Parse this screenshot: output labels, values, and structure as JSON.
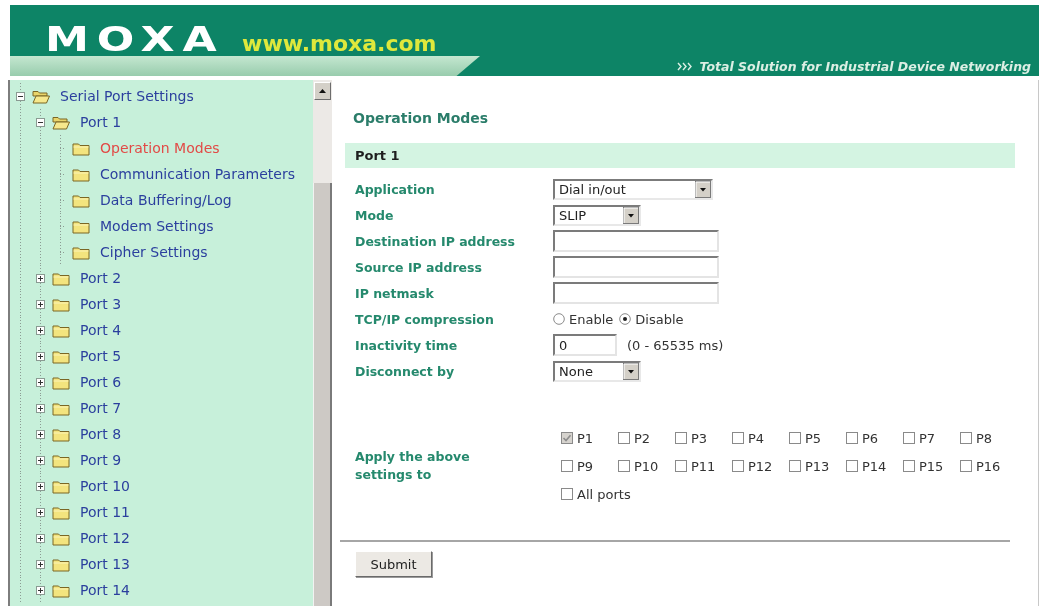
{
  "header": {
    "logo": "MOXA",
    "website": "www.moxa.com",
    "tagline": "Total Solution for Industrial Device Networking"
  },
  "sidebar": {
    "tree": [
      {
        "label": "Serial Port Settings",
        "expanded": true,
        "selected": false,
        "children": [
          {
            "label": "Port 1",
            "expanded": true,
            "selected": false,
            "children": [
              {
                "label": "Operation Modes",
                "selected": true
              },
              {
                "label": "Communication Parameters",
                "selected": false
              },
              {
                "label": "Data Buffering/Log",
                "selected": false
              },
              {
                "label": "Modem Settings",
                "selected": false
              },
              {
                "label": "Cipher Settings",
                "selected": false
              }
            ]
          },
          {
            "label": "Port 2",
            "expanded": false,
            "selected": false
          },
          {
            "label": "Port 3",
            "expanded": false,
            "selected": false
          },
          {
            "label": "Port 4",
            "expanded": false,
            "selected": false
          },
          {
            "label": "Port 5",
            "expanded": false,
            "selected": false
          },
          {
            "label": "Port 6",
            "expanded": false,
            "selected": false
          },
          {
            "label": "Port 7",
            "expanded": false,
            "selected": false
          },
          {
            "label": "Port 8",
            "expanded": false,
            "selected": false
          },
          {
            "label": "Port 9",
            "expanded": false,
            "selected": false
          },
          {
            "label": "Port 10",
            "expanded": false,
            "selected": false
          },
          {
            "label": "Port 11",
            "expanded": false,
            "selected": false
          },
          {
            "label": "Port 12",
            "expanded": false,
            "selected": false
          },
          {
            "label": "Port 13",
            "expanded": false,
            "selected": false
          },
          {
            "label": "Port 14",
            "expanded": false,
            "selected": false
          }
        ]
      }
    ]
  },
  "content": {
    "title": "Operation Modes",
    "section": "Port 1",
    "fields": [
      {
        "kind": "select",
        "label": "Application",
        "value": "Dial in/out"
      },
      {
        "kind": "select",
        "label": "Mode",
        "value": "SLIP"
      },
      {
        "kind": "text",
        "label": "Destination IP address"
      },
      {
        "kind": "text",
        "label": "Source IP address"
      },
      {
        "kind": "text",
        "label": "IP netmask"
      },
      {
        "kind": "radio",
        "label": "TCP/IP compression",
        "options": [
          {
            "label": "Enable",
            "selected": false
          },
          {
            "label": "Disable",
            "selected": true
          }
        ]
      },
      {
        "kind": "text",
        "label": "Inactivity time",
        "value": "0",
        "unit": "(0 - 65535 ms)"
      },
      {
        "kind": "select",
        "label": "Disconnect by",
        "value": "None"
      },
      {
        "kind": "checkboxes",
        "label": "Apply the above settings to",
        "options": [
          {
            "label": "P1",
            "checked": true,
            "disabled": true
          },
          {
            "label": "P2",
            "checked": false,
            "disabled": false
          },
          {
            "label": "P3",
            "checked": false,
            "disabled": false
          },
          {
            "label": "P4",
            "checked": false,
            "disabled": false
          },
          {
            "label": "P5",
            "checked": false,
            "disabled": false
          },
          {
            "label": "P6",
            "checked": false,
            "disabled": false
          },
          {
            "label": "P7",
            "checked": false,
            "disabled": false
          },
          {
            "label": "P8",
            "checked": false,
            "disabled": false
          },
          {
            "label": "P9",
            "checked": false,
            "disabled": false
          },
          {
            "label": "P10",
            "checked": false,
            "disabled": false
          },
          {
            "label": "P11",
            "checked": false,
            "disabled": false
          },
          {
            "label": "P12",
            "checked": false,
            "disabled": false
          },
          {
            "label": "P13",
            "checked": false,
            "disabled": false
          },
          {
            "label": "P14",
            "checked": false,
            "disabled": false
          },
          {
            "label": "P15",
            "checked": false,
            "disabled": false
          },
          {
            "label": "P16",
            "checked": false,
            "disabled": false
          },
          {
            "label": "All ports",
            "checked": false,
            "disabled": false
          }
        ]
      }
    ],
    "submit": "Submit"
  }
}
